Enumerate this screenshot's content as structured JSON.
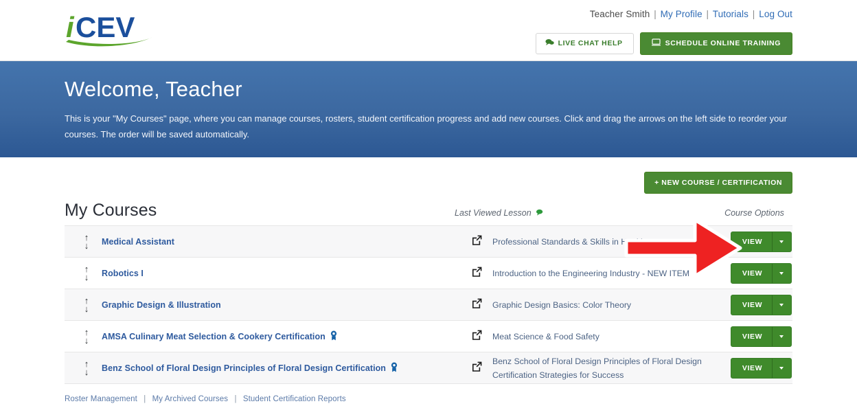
{
  "brand": {
    "logo_text_i": "i",
    "logo_text_cev": "CEV",
    "logo_name": "iCEV"
  },
  "header": {
    "user_name": "Teacher Smith",
    "links": [
      {
        "label": "My Profile"
      },
      {
        "label": "Tutorials"
      },
      {
        "label": "Log Out"
      }
    ],
    "separator": "|",
    "live_chat_label": "LIVE CHAT HELP",
    "schedule_label": "SCHEDULE ONLINE TRAINING"
  },
  "banner": {
    "title": "Welcome, Teacher",
    "description": "This is your \"My Courses\" page, where you can manage courses, rosters, student certification progress and add new courses. Click and drag the arrows on the left side to reorder your courses. The order will be saved automatically."
  },
  "main": {
    "new_course_label": "+ NEW COURSE / CERTIFICATION",
    "section_title": "My Courses",
    "col_lesson_label": "Last Viewed Lesson",
    "col_options_label": "Course Options",
    "view_button_label": "VIEW",
    "courses": [
      {
        "name": "Medical Assistant",
        "certified": false,
        "lesson": "Professional Standards & Skills in Healthcare - NEW ITEM",
        "view_label": "VIEW"
      },
      {
        "name": "Robotics I",
        "certified": false,
        "lesson": "Introduction to the Engineering Industry - NEW ITEM",
        "view_label": "VIEW"
      },
      {
        "name": "Graphic Design & Illustration",
        "certified": false,
        "lesson": "Graphic Design Basics: Color Theory",
        "view_label": "VIEW"
      },
      {
        "name": "AMSA Culinary Meat Selection & Cookery Certification",
        "certified": true,
        "lesson": "Meat Science & Food Safety",
        "view_label": "VIEW"
      },
      {
        "name": "Benz School of Floral Design Principles of Floral Design Certification",
        "certified": true,
        "lesson": "Benz School of Floral Design Principles of Floral Design Certification Strategies for Success",
        "view_label": "VIEW"
      }
    ]
  },
  "footer": {
    "links": [
      {
        "label": "Roster Management"
      },
      {
        "label": "My Archived Courses"
      },
      {
        "label": "Student Certification Reports"
      }
    ],
    "separator": "|"
  },
  "annotation": {
    "type": "arrow",
    "direction": "right",
    "color": "#ee2222",
    "points_to": "view-button-row-1"
  },
  "colors": {
    "brand_blue": "#1b4f9c",
    "brand_green": "#5ca52c",
    "banner_blue": "#3c68a0",
    "button_green": "#4a8a33",
    "link_blue": "#2e6bb5",
    "annotation_red": "#ee2222"
  }
}
